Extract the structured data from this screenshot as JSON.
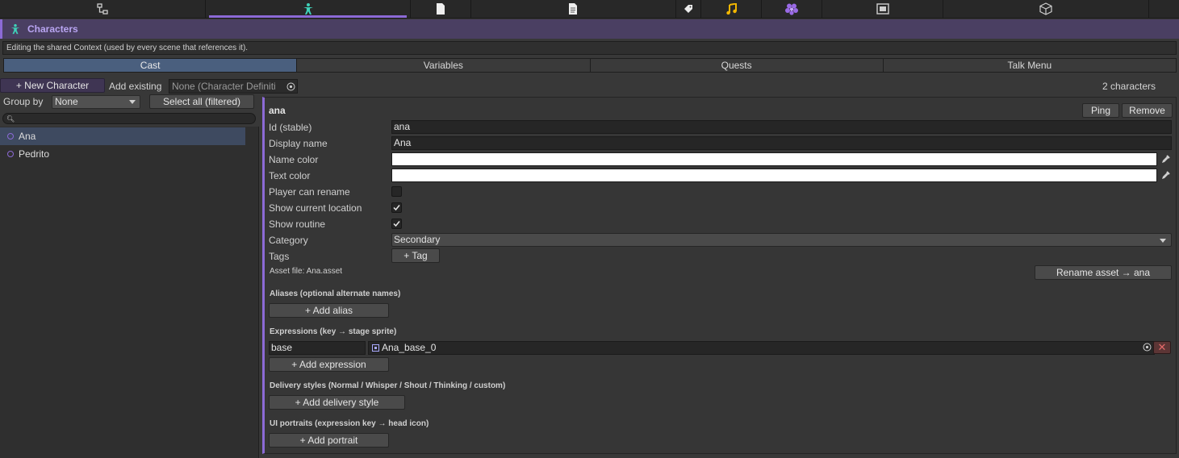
{
  "top_tabs": [
    {
      "icon": "hierarchy-icon"
    },
    {
      "icon": "character-icon",
      "active": true
    },
    {
      "icon": "document-icon"
    },
    {
      "icon": "notes-icon"
    },
    {
      "icon": "tag-icon"
    },
    {
      "icon": "music-icon"
    },
    {
      "icon": "flower-icon"
    },
    {
      "icon": "frame-icon"
    },
    {
      "icon": "cube-icon"
    }
  ],
  "header": {
    "title": "Characters",
    "icon": "character-icon"
  },
  "context_note": "Editing the shared Context (used by every scene that references it).",
  "section_tabs": [
    "Cast",
    "Variables",
    "Quests",
    "Talk Menu"
  ],
  "active_section_tab": "Cast",
  "toolbar": {
    "new_character": "+ New Character",
    "add_existing": "Add existing",
    "object_field": "None (Character Definiti",
    "count": "2 characters",
    "group_by_label": "Group by",
    "group_by_value": "None",
    "select_all": "Select all (filtered)",
    "search_value": ""
  },
  "characters": [
    {
      "name": "Ana",
      "selected": true
    },
    {
      "name": "Pedrito",
      "selected": false
    }
  ],
  "inspector": {
    "name": "ana",
    "ping": "Ping",
    "remove": "Remove",
    "fields": {
      "id_label": "Id (stable)",
      "id_value": "ana",
      "display_label": "Display name",
      "display_value": "Ana",
      "name_color_label": "Name color",
      "name_color": "#ffffff",
      "text_color_label": "Text color",
      "text_color": "#ffffff",
      "player_rename_label": "Player can rename",
      "player_rename": false,
      "show_location_label": "Show current location",
      "show_location": true,
      "show_routine_label": "Show routine",
      "show_routine": true,
      "category_label": "Category",
      "category_value": "Secondary",
      "tags_label": "Tags",
      "tag_button": "+ Tag"
    },
    "asset_file": "Asset file: Ana.asset",
    "rename_asset": "Rename asset → ana",
    "aliases_title": "Aliases (optional alternate names)",
    "add_alias": "+ Add alias",
    "expressions_title": "Expressions (key → stage sprite)",
    "expression": {
      "key": "base",
      "sprite": "Ana_base_0"
    },
    "add_expression": "+ Add expression",
    "delivery_title": "Delivery styles (Normal / Whisper / Shout / Thinking / custom)",
    "add_delivery": "+ Add delivery style",
    "portraits_title": "UI portraits (expression key → head icon)",
    "add_portrait": "+ Add portrait"
  }
}
